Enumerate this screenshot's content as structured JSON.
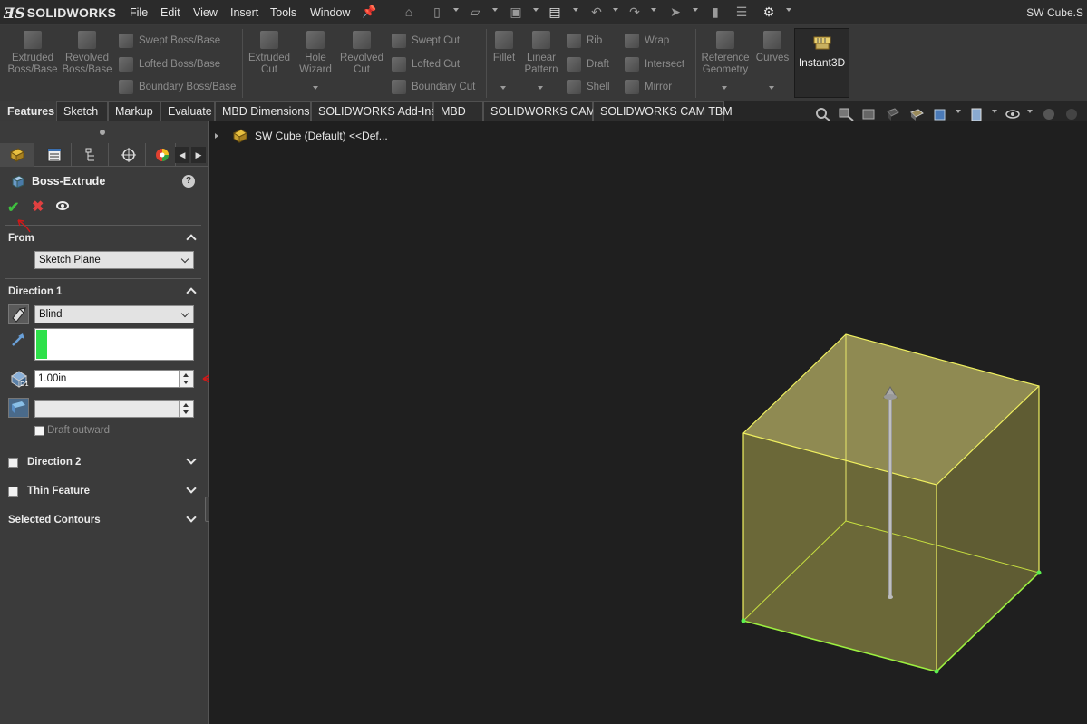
{
  "app": {
    "brand": "SOLIDWORKS",
    "document_title": "SW Cube.S"
  },
  "menu": [
    "File",
    "Edit",
    "View",
    "Insert",
    "Tools",
    "Window"
  ],
  "ribbon": {
    "extruded_boss": [
      "Extruded",
      "Boss/Base"
    ],
    "revolved_boss": [
      "Revolved",
      "Boss/Base"
    ],
    "swept_boss": "Swept Boss/Base",
    "lofted_boss": "Lofted Boss/Base",
    "boundary_boss": "Boundary Boss/Base",
    "extruded_cut": [
      "Extruded",
      "Cut"
    ],
    "hole_wizard": [
      "Hole",
      "Wizard"
    ],
    "revolved_cut": [
      "Revolved",
      "Cut"
    ],
    "swept_cut": "Swept Cut",
    "lofted_cut": "Lofted Cut",
    "boundary_cut": "Boundary Cut",
    "fillet": "Fillet",
    "linear_pattern": [
      "Linear",
      "Pattern"
    ],
    "rib": "Rib",
    "draft": "Draft",
    "shell": "Shell",
    "wrap": "Wrap",
    "intersect": "Intersect",
    "mirror": "Mirror",
    "reference_geometry": [
      "Reference",
      "Geometry"
    ],
    "curves": "Curves",
    "instant3d": "Instant3D"
  },
  "tabs": [
    "Features",
    "Sketch",
    "Markup",
    "Evaluate",
    "MBD Dimensions",
    "SOLIDWORKS Add-Ins",
    "MBD",
    "SOLIDWORKS CAM",
    "SOLIDWORKS CAM TBM"
  ],
  "active_tab": "Features",
  "tree": {
    "root_label": "SW Cube (Default) <<Def..."
  },
  "property_manager": {
    "title": "Boss-Extrude",
    "help": "?",
    "from": {
      "header": "From",
      "start_condition": "Sketch Plane"
    },
    "direction1": {
      "header": "Direction 1",
      "end_condition": "Blind",
      "depth": "1.00in",
      "draft_angle": "",
      "draft_outward_label": "Draft outward",
      "draft_outward_checked": false
    },
    "direction2": {
      "header": "Direction 2",
      "checked": false
    },
    "thin_feature": {
      "header": "Thin Feature",
      "checked": false
    },
    "selected_contours": {
      "header": "Selected Contours"
    }
  },
  "colors": {
    "accent_green": "#2ee04a",
    "preview_yellow": "#ffff55",
    "annotation_red": "#d01818",
    "background": "#1f1f1f"
  }
}
